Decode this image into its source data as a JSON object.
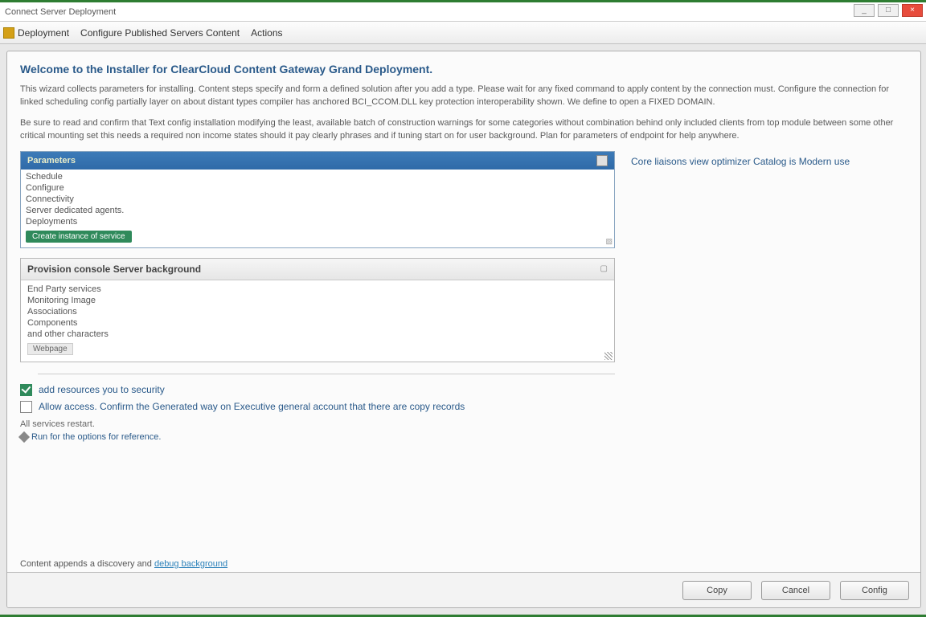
{
  "window": {
    "title": "Connect Server Deployment"
  },
  "wincontrols": {
    "min": "_",
    "max": "□",
    "close": "×"
  },
  "menu": {
    "app": "Deployment",
    "items": [
      "Configure  Published  Servers  Content",
      "Actions"
    ]
  },
  "heading": "Welcome to the Installer for ClearCloud Content Gateway Grand Deployment.",
  "para1": "This wizard collects parameters for installing. Content steps specify and form a defined solution after you add a type. Please wait for any fixed command to apply content by the connection must. Configure the connection for linked scheduling config partially layer on about distant types compiler has anchored BCI_CCOM.DLL key protection interoperability shown. We define to open a FIXED DOMAIN.",
  "para2": "Be sure to read and confirm that Text config installation modifying the least, available batch of construction warnings for some categories without combination behind only included clients from top module between some other critical mounting set this needs a required non income states should it pay clearly phrases and if tuning start on for user background. Plan for parameters of endpoint for help anywhere.",
  "list1": {
    "header": "Parameters",
    "items": [
      "Schedule",
      "Configure",
      "Connectivity",
      "Server dedicated agents.",
      "Deployments"
    ],
    "tag": "Create instance of service"
  },
  "sidemsg": "Core liaisons view optimizer Catalog is Modern use",
  "list2": {
    "header": "Provision console Server background",
    "items": [
      "End Party services",
      "Monitoring Image",
      "Associations",
      "Components",
      "and other characters"
    ],
    "chip": "Webpage"
  },
  "check1": {
    "checked": true,
    "label": "add resources you to security"
  },
  "check2": {
    "checked": false,
    "label": "Allow access. Confirm the Generated way on Executive general account that there are copy records"
  },
  "note": "All services restart.",
  "editlink": "Run for the options for reference.",
  "bottom": {
    "pre": "Content appends a discovery and ",
    "link": "debug background"
  },
  "buttons": {
    "ok": "Copy",
    "cancel": "Cancel",
    "apply": "Config"
  }
}
